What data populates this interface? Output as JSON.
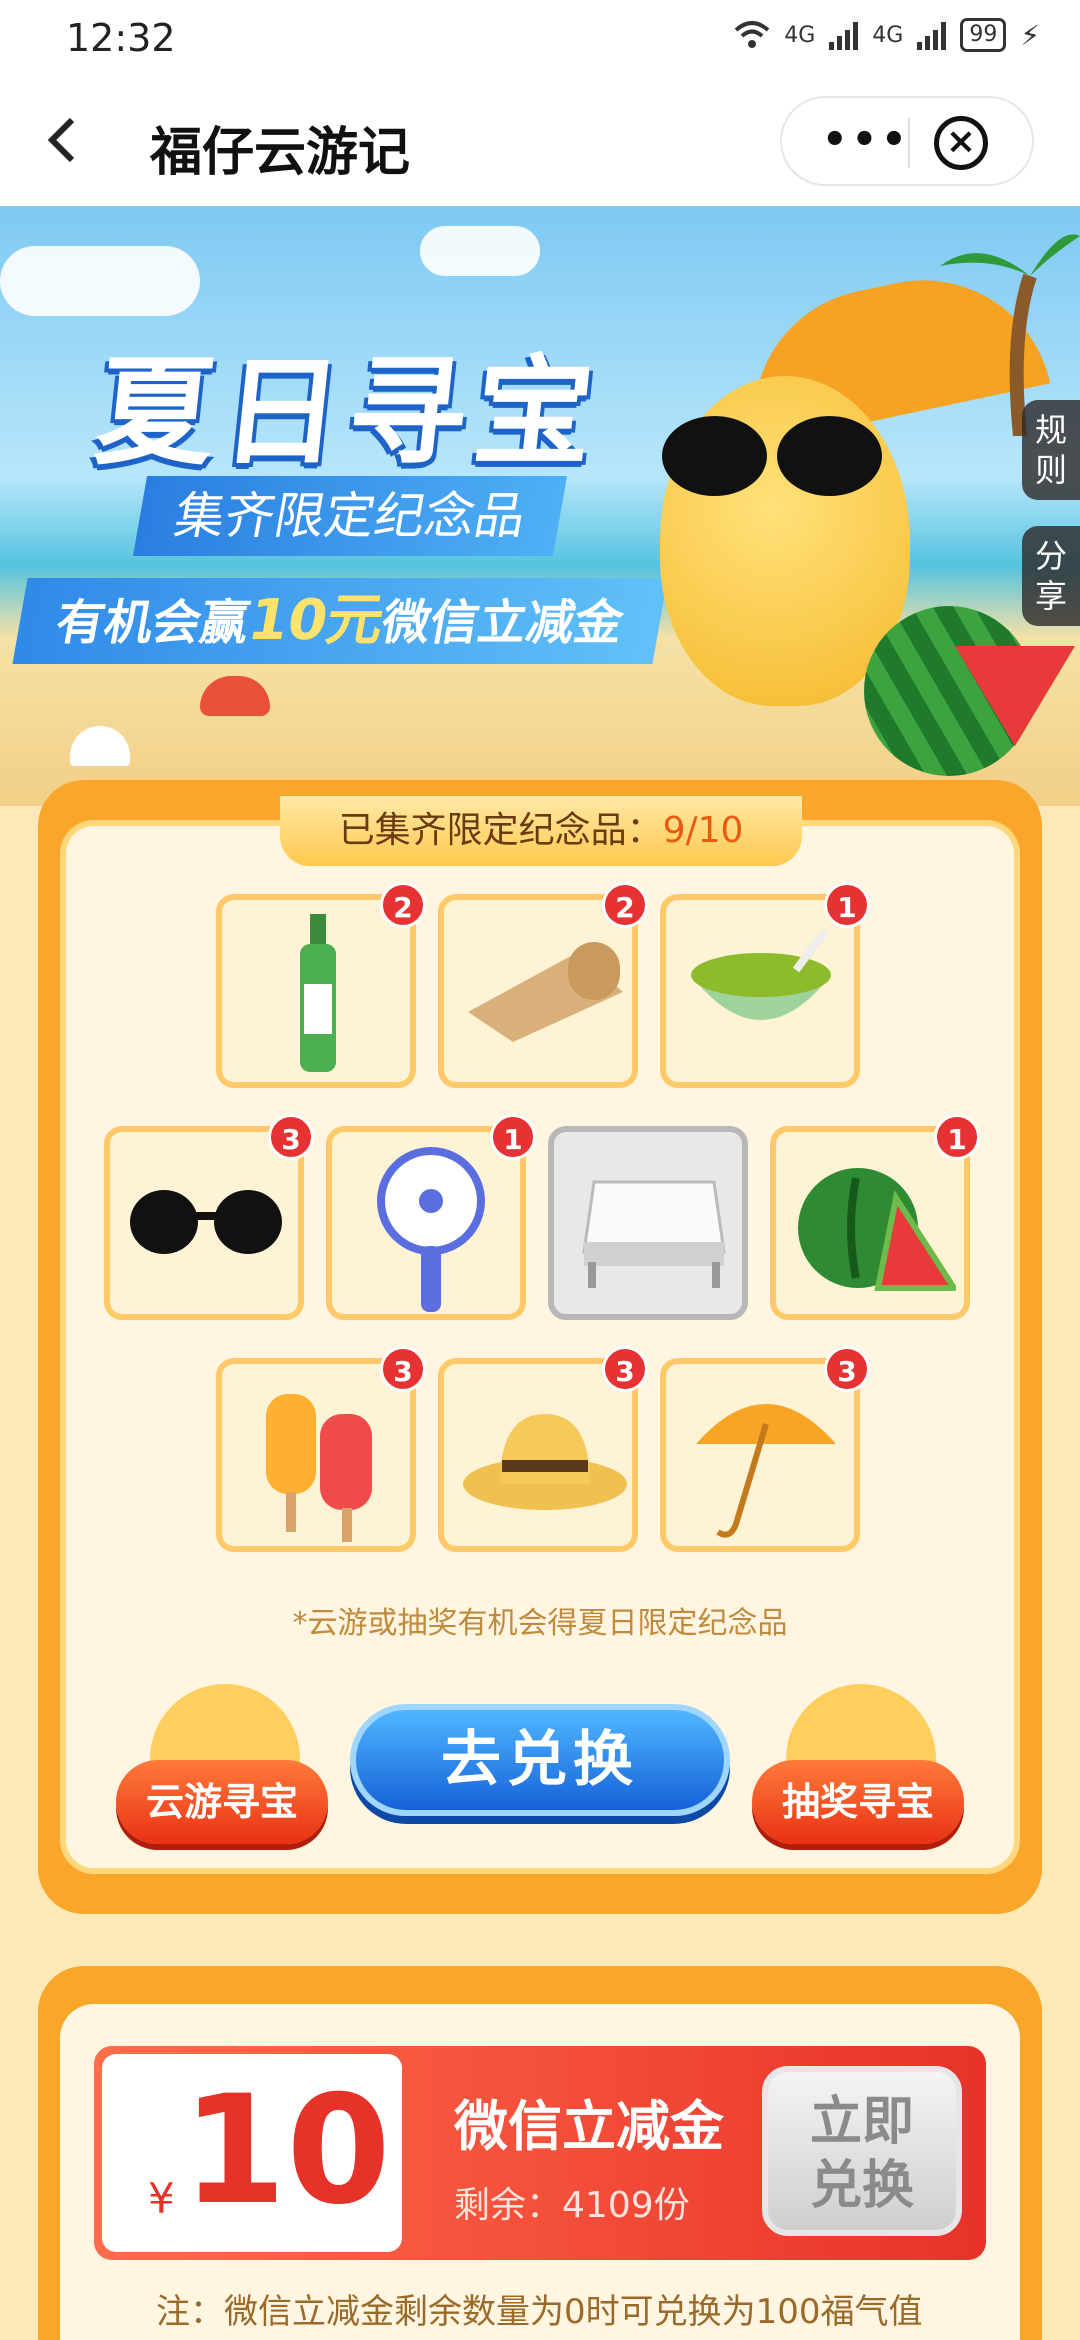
{
  "status_bar": {
    "time": "12:32",
    "network1": "4G",
    "network2": "4G",
    "battery": "99"
  },
  "nav": {
    "back_label": "<",
    "title": "福仔云游记",
    "more_label": "•••",
    "close_label": "×"
  },
  "hero": {
    "title": "夏日寻宝",
    "subtitle1": "集齐限定纪念品",
    "subtitle2_prefix": "有机会赢",
    "subtitle2_highlight": "10元",
    "subtitle2_suffix": "微信立减金"
  },
  "side_tabs": {
    "rules": "规则",
    "share": "分享"
  },
  "collection": {
    "label": "已集齐限定纪念品：",
    "count": "9/10",
    "items": [
      {
        "name": "花露水",
        "count": "2",
        "icon": "toilet-water-bottle-icon"
      },
      {
        "name": "凉席",
        "count": "2",
        "icon": "bamboo-mat-icon"
      },
      {
        "name": "绿豆汤",
        "count": "1",
        "icon": "mung-bean-soup-icon"
      },
      {
        "name": "墨镜",
        "count": "3",
        "icon": "sunglasses-icon"
      },
      {
        "name": "小风扇",
        "count": "1",
        "icon": "handheld-fan-icon"
      },
      {
        "name": "蚊帐",
        "count": "",
        "icon": "mosquito-net-bed-icon"
      },
      {
        "name": "西瓜",
        "count": "1",
        "icon": "watermelon-icon"
      },
      {
        "name": "冰棍",
        "count": "3",
        "icon": "popsicle-icon"
      },
      {
        "name": "草帽",
        "count": "3",
        "icon": "straw-hat-icon"
      },
      {
        "name": "遮阳伞",
        "count": "3",
        "icon": "umbrella-icon"
      }
    ],
    "hint": "*云游或抽奖有机会得夏日限定纪念品"
  },
  "actions": {
    "cloud_travel": "云游寻宝",
    "exchange": "去兑换",
    "lottery": "抽奖寻宝"
  },
  "coupon": {
    "currency": "¥",
    "amount": "10",
    "name": "微信立减金",
    "remaining_label": "剩余：",
    "remaining_value": "4109份",
    "redeem_line1": "立即",
    "redeem_line2": "兑换"
  },
  "note": "注：微信立减金剩余数量为0时可兑换为100福气值",
  "colors": {
    "accent_orange": "#f9a62a",
    "badge_red": "#e63232",
    "button_blue": "#1662d8",
    "coupon_red": "#e8322a"
  }
}
